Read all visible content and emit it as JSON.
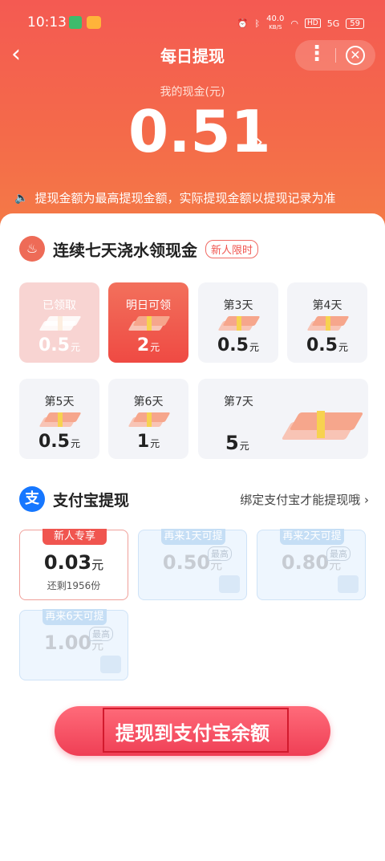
{
  "status_bar": {
    "time": "10:13",
    "speed_value": "40.0",
    "speed_unit": "KB/S",
    "signal": "5G",
    "hd": "HD",
    "battery": "59"
  },
  "nav": {
    "title": "每日提现",
    "more": "⋮",
    "close": "✕"
  },
  "cash": {
    "label": "我的现金(元)",
    "amount": "0.51",
    "arrow": "›"
  },
  "notice": "提现金额为最高提现金额，实际提现金额以提现记录为准",
  "streak": {
    "title": "连续七天浇水领现金",
    "tag": "新人限时",
    "days": [
      {
        "label": "已领取",
        "value": "0.5",
        "unit": "元"
      },
      {
        "label": "明日可领",
        "value": "2",
        "unit": "元"
      },
      {
        "label": "第3天",
        "value": "0.5",
        "unit": "元"
      },
      {
        "label": "第4天",
        "value": "0.5",
        "unit": "元"
      },
      {
        "label": "第5天",
        "value": "0.5",
        "unit": "元"
      },
      {
        "label": "第6天",
        "value": "1",
        "unit": "元"
      },
      {
        "label": "第7天",
        "value": "5",
        "unit": "元"
      }
    ]
  },
  "alipay": {
    "icon": "支",
    "title": "支付宝提现",
    "bind_link": "绑定支付宝才能提现哦 ›",
    "options": [
      {
        "head": "新人专享",
        "amount": "0.03",
        "unit": "元",
        "remain": "还剩1956份"
      },
      {
        "head": "再来1天可提",
        "amount": "0.50",
        "unit": "元",
        "max": "最高"
      },
      {
        "head": "再来2天可提",
        "amount": "0.80",
        "unit": "元",
        "max": "最高"
      },
      {
        "head": "再来6天可提",
        "amount": "1.00",
        "unit": "元",
        "max": "最高"
      }
    ]
  },
  "cta": {
    "label": "提现到支付宝余额"
  }
}
